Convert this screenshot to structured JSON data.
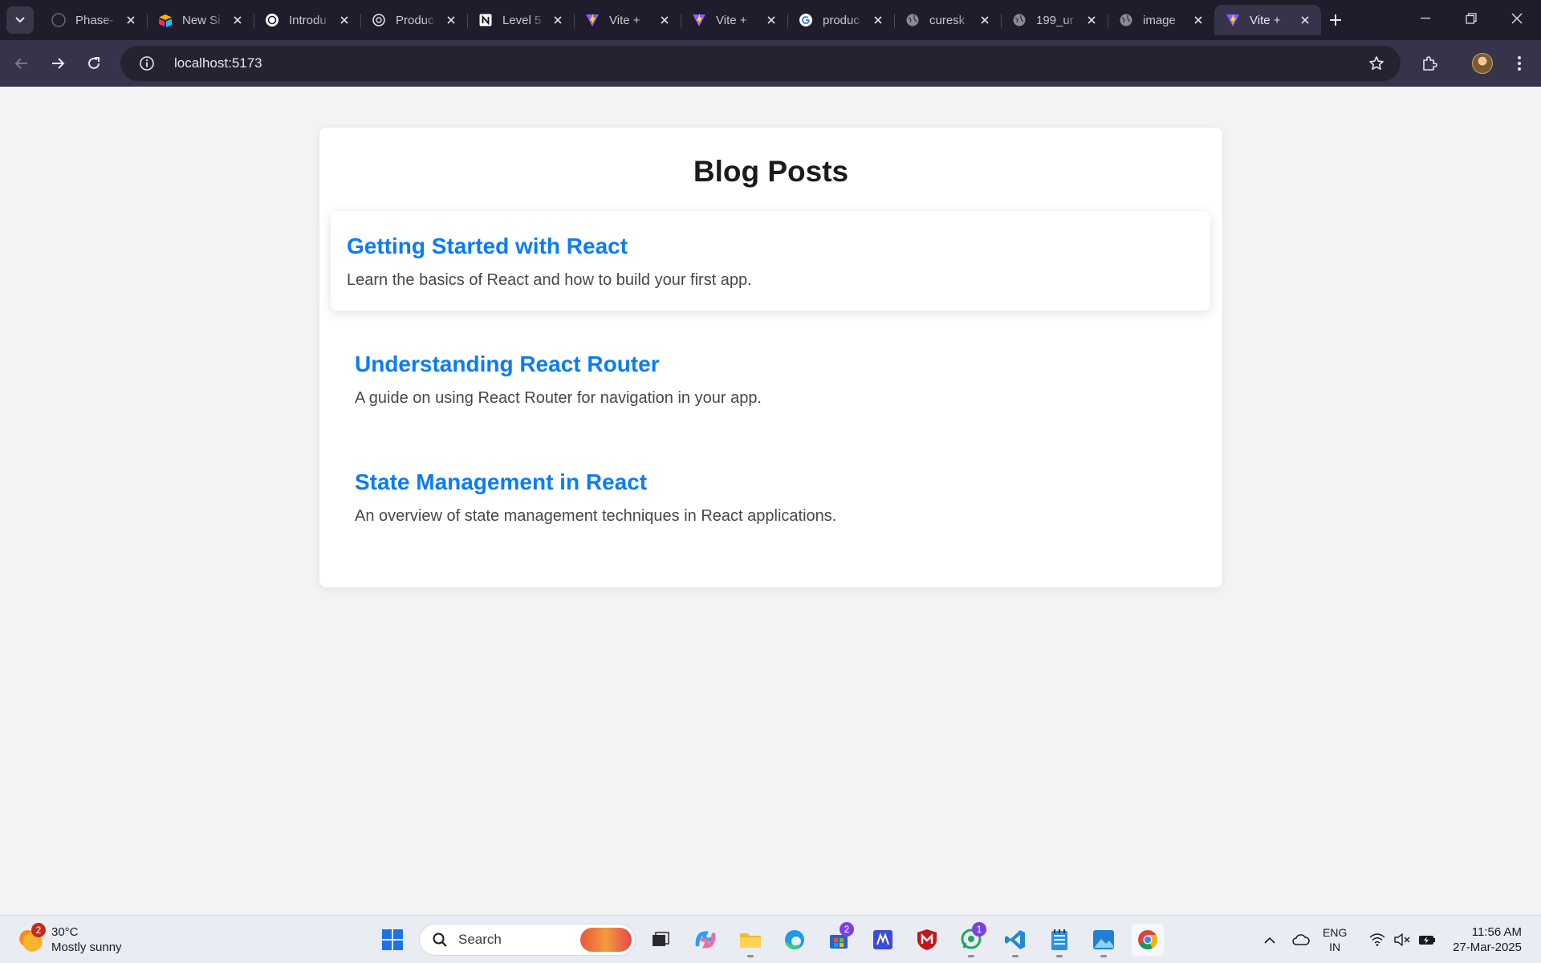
{
  "browser": {
    "tabs": [
      {
        "title": "Phase-",
        "icon": "github-icon",
        "active": false
      },
      {
        "title": "New Si",
        "icon": "airtable-icon",
        "active": false
      },
      {
        "title": "Introdu",
        "icon": "openai-icon",
        "active": false
      },
      {
        "title": "Produc",
        "icon": "openai-icon",
        "active": false
      },
      {
        "title": "Level 5",
        "icon": "notion-icon",
        "active": false
      },
      {
        "title": "Vite +",
        "icon": "vite-icon",
        "active": false
      },
      {
        "title": "Vite +",
        "icon": "vite-icon",
        "active": false
      },
      {
        "title": "produc",
        "icon": "google-icon",
        "active": false
      },
      {
        "title": "curesk",
        "icon": "globe-icon",
        "active": false
      },
      {
        "title": "199_ur",
        "icon": "globe-icon",
        "active": false
      },
      {
        "title": "image",
        "icon": "globe-icon",
        "active": false
      },
      {
        "title": "Vite +",
        "icon": "vite-icon",
        "active": true
      }
    ],
    "address": "localhost:5173"
  },
  "page": {
    "title": "Blog Posts",
    "posts": [
      {
        "title": "Getting Started with React",
        "excerpt": "Learn the basics of React and how to build your first app."
      },
      {
        "title": "Understanding React Router",
        "excerpt": "A guide on using React Router for navigation in your app."
      },
      {
        "title": "State Management in React",
        "excerpt": "An overview of state management techniques in React applications."
      }
    ],
    "colors": {
      "link": "#0a7cf5",
      "excerpt": "#484848",
      "background": "#f3f3f5"
    }
  },
  "taskbar": {
    "weather": {
      "temp": "30°C",
      "desc": "Mostly sunny",
      "badge": "2"
    },
    "search_label": "Search",
    "store_badge": "2",
    "whatsapp_badge": "1",
    "language": {
      "line1": "ENG",
      "line2": "IN"
    },
    "clock": {
      "time": "11:56 AM",
      "date": "27-Mar-2025"
    }
  }
}
